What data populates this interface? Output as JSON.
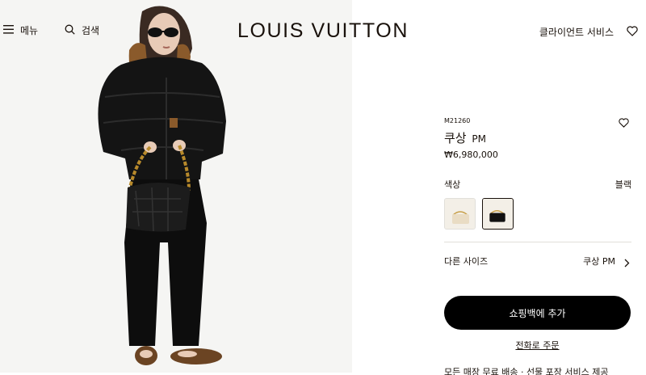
{
  "header": {
    "menu_label": "메뉴",
    "search_label": "검색",
    "logo": "LOUIS VUITTON",
    "client_services": "클라이언트 서비스"
  },
  "product": {
    "sku": "M21260",
    "name": "쿠상",
    "size": "PM",
    "price": "₩6,980,000",
    "color_label": "색상",
    "color_value": "블랙",
    "swatches": [
      "cream",
      "black"
    ],
    "selected_swatch": "black",
    "other_sizes_label": "다른 사이즈",
    "other_sizes_value": "쿠상 PM",
    "add_to_cart": "쇼핑백에 추가",
    "phone_order": "전화로 주문",
    "cutoff_text": "모든 매장 무료 배송 · 선물 포장 서비스 제공"
  },
  "colors": {
    "text": "#19110b",
    "button_bg": "#000000",
    "button_text": "#ffffff",
    "divider": "#e1dfda",
    "image_bg": "#f5f5f3"
  },
  "icons": [
    "menu-icon",
    "search-icon",
    "heart-icon",
    "chevron-right-icon"
  ]
}
